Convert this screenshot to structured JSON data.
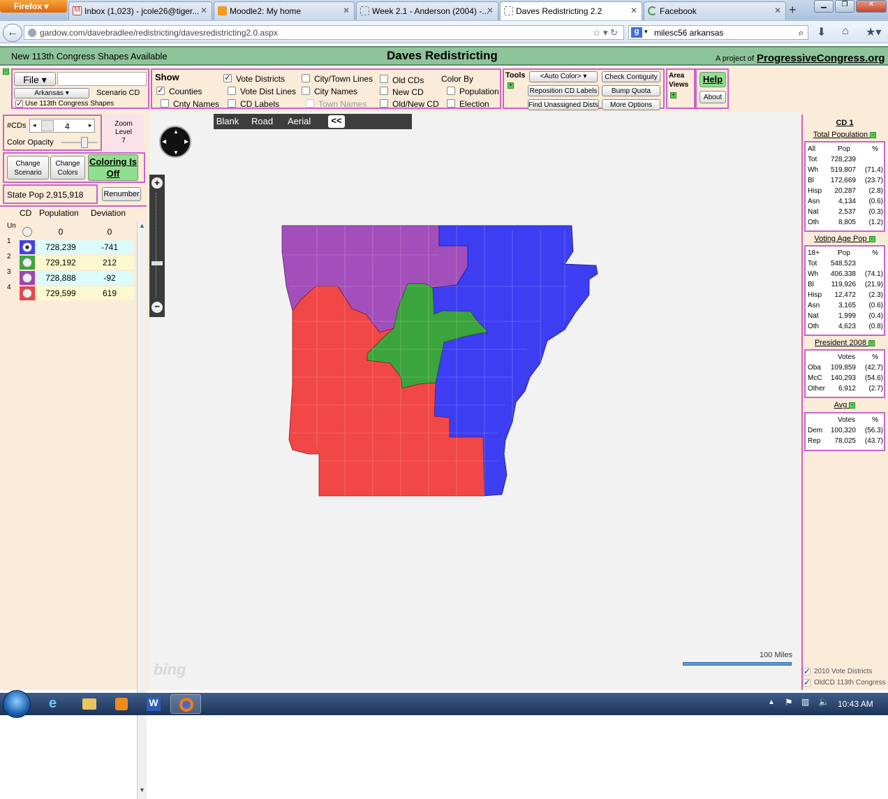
{
  "browser": {
    "app_button": "Firefox",
    "tabs": [
      {
        "label": "Inbox (1,023) - jcole26@tiger...",
        "icon": "gmail-icon"
      },
      {
        "label": "Moodle2: My home",
        "icon": "moodle-icon"
      },
      {
        "label": "Week 2.1 - Anderson (2004) -...",
        "icon": "page-icon"
      },
      {
        "label": "Daves Redistricting 2.2",
        "icon": "page-icon",
        "active": true
      },
      {
        "label": "Facebook",
        "icon": "loading-icon"
      }
    ],
    "url": "gardow.com/davebradlee/redistricting/davesredistricting2.0.aspx",
    "search_value": "milesc56 arkansas"
  },
  "header": {
    "left_text": "New 113th Congress Shapes Available",
    "title": "Daves Redistricting",
    "project_prefix": "A project of",
    "project_link": "ProgressiveCongress.org"
  },
  "toolbar": {
    "file_label": "File",
    "state_select": "Arkansas",
    "scenario_label": "Scenario CD",
    "use_113_label": "Use 113th Congress Shapes",
    "show_title": "Show",
    "show": {
      "counties": "Counties",
      "cnty_names": "Cnty Names",
      "vote_districts": "Vote Districts",
      "vote_dist_lines": "Vote Dist Lines",
      "cd_labels": "CD Labels",
      "city_town_lines": "City/Town Lines",
      "city_names": "City Names",
      "town_names": "Town Names",
      "old_cds": "Old CDs",
      "new_cd": "New CD",
      "old_new_cd": "Old/New CD"
    },
    "color_by_title": "Color By",
    "color_by": {
      "population": "Population",
      "election": "Election"
    },
    "tools_title": "Tools",
    "auto_color": "<Auto Color>",
    "reposition": "Reposition CD Labels",
    "find_unassigned": "Find Unassigned Dists",
    "check_contiguity": "Check Contiguity",
    "bump_quota": "Bump Quota",
    "more_options": "More Options",
    "area_views": "Area Views",
    "help": "Help",
    "about": "About"
  },
  "left": {
    "num_cds_label": "#CDs",
    "num_cds_value": "4",
    "zoom_label": "Zoom Level",
    "zoom_value": "7",
    "opacity_label": "Color Opacity",
    "change_scenario": "Change Scenario",
    "change_colors": "Change Colors",
    "coloring": "Coloring Is Off",
    "state_pop_label": "State Pop",
    "state_pop_value": "2,915,918",
    "renumber": "Renumber",
    "col_cd": "CD",
    "col_pop": "Population",
    "col_dev": "Deviation",
    "rows": [
      {
        "cd": "Un",
        "color": "#ffffff",
        "pop": "0",
        "dev": "0"
      },
      {
        "cd": "1",
        "color": "#3f3ff5",
        "pop": "728,239",
        "dev": "-741"
      },
      {
        "cd": "2",
        "color": "#3aa83a",
        "pop": "729,192",
        "dev": "212"
      },
      {
        "cd": "3",
        "color": "#a044b8",
        "pop": "728,888",
        "dev": "-92"
      },
      {
        "cd": "4",
        "color": "#f24444",
        "pop": "729,599",
        "dev": "619"
      }
    ]
  },
  "map": {
    "tabs": [
      "Blank",
      "Road",
      "Aerial"
    ],
    "collapse": "<<",
    "logo": "bing",
    "scale": "100 Miles",
    "colors": {
      "purple": "#a24fbb",
      "blue": "#3d3df2",
      "green": "#3ca43c",
      "red": "#f24747"
    }
  },
  "right": {
    "cd_title": "CD 1",
    "total_pop_title": "Total Population",
    "total_pop_head": [
      "All",
      "Pop",
      "%"
    ],
    "total_pop": [
      [
        "Tot",
        "728,239",
        ""
      ],
      [
        "Wh",
        "519,807",
        "(71.4)"
      ],
      [
        "Bl",
        "172,669",
        "(23.7)"
      ],
      [
        "Hisp",
        "20,287",
        "(2.8)"
      ],
      [
        "Asn",
        "4,134",
        "(0.6)"
      ],
      [
        "Nat",
        "2,537",
        "(0.3)"
      ],
      [
        "Oth",
        "8,805",
        "(1.2)"
      ]
    ],
    "vap_title": "Voting Age Pop",
    "vap_head": [
      "18+",
      "Pop",
      "%"
    ],
    "vap": [
      [
        "Tot",
        "548,523",
        ""
      ],
      [
        "Wh",
        "406,338",
        "(74.1)"
      ],
      [
        "Bl",
        "119,926",
        "(21.9)"
      ],
      [
        "Hisp",
        "12,472",
        "(2.3)"
      ],
      [
        "Asn",
        "3,165",
        "(0.6)"
      ],
      [
        "Nat",
        "1,999",
        "(0.4)"
      ],
      [
        "Oth",
        "4,623",
        "(0.8)"
      ]
    ],
    "pres_title": "President 2008",
    "pres_head": [
      "",
      "Votes",
      "%"
    ],
    "pres": [
      [
        "Oba",
        "109,859",
        "(42.7)"
      ],
      [
        "McC",
        "140,293",
        "(54.6)"
      ],
      [
        "Other",
        "6,912",
        "(2.7)"
      ]
    ],
    "avg_title": "Avg",
    "avg_head": [
      "",
      "Votes",
      "%"
    ],
    "avg": [
      [
        "Dem",
        "100,320",
        "(56.3)"
      ],
      [
        "Rep",
        "78,025",
        "(43.7)"
      ]
    ],
    "legend_2010": "2010 Vote Districts",
    "legend_old": "OldCD 113th Congress"
  },
  "taskbar": {
    "time": "10:43 AM"
  }
}
